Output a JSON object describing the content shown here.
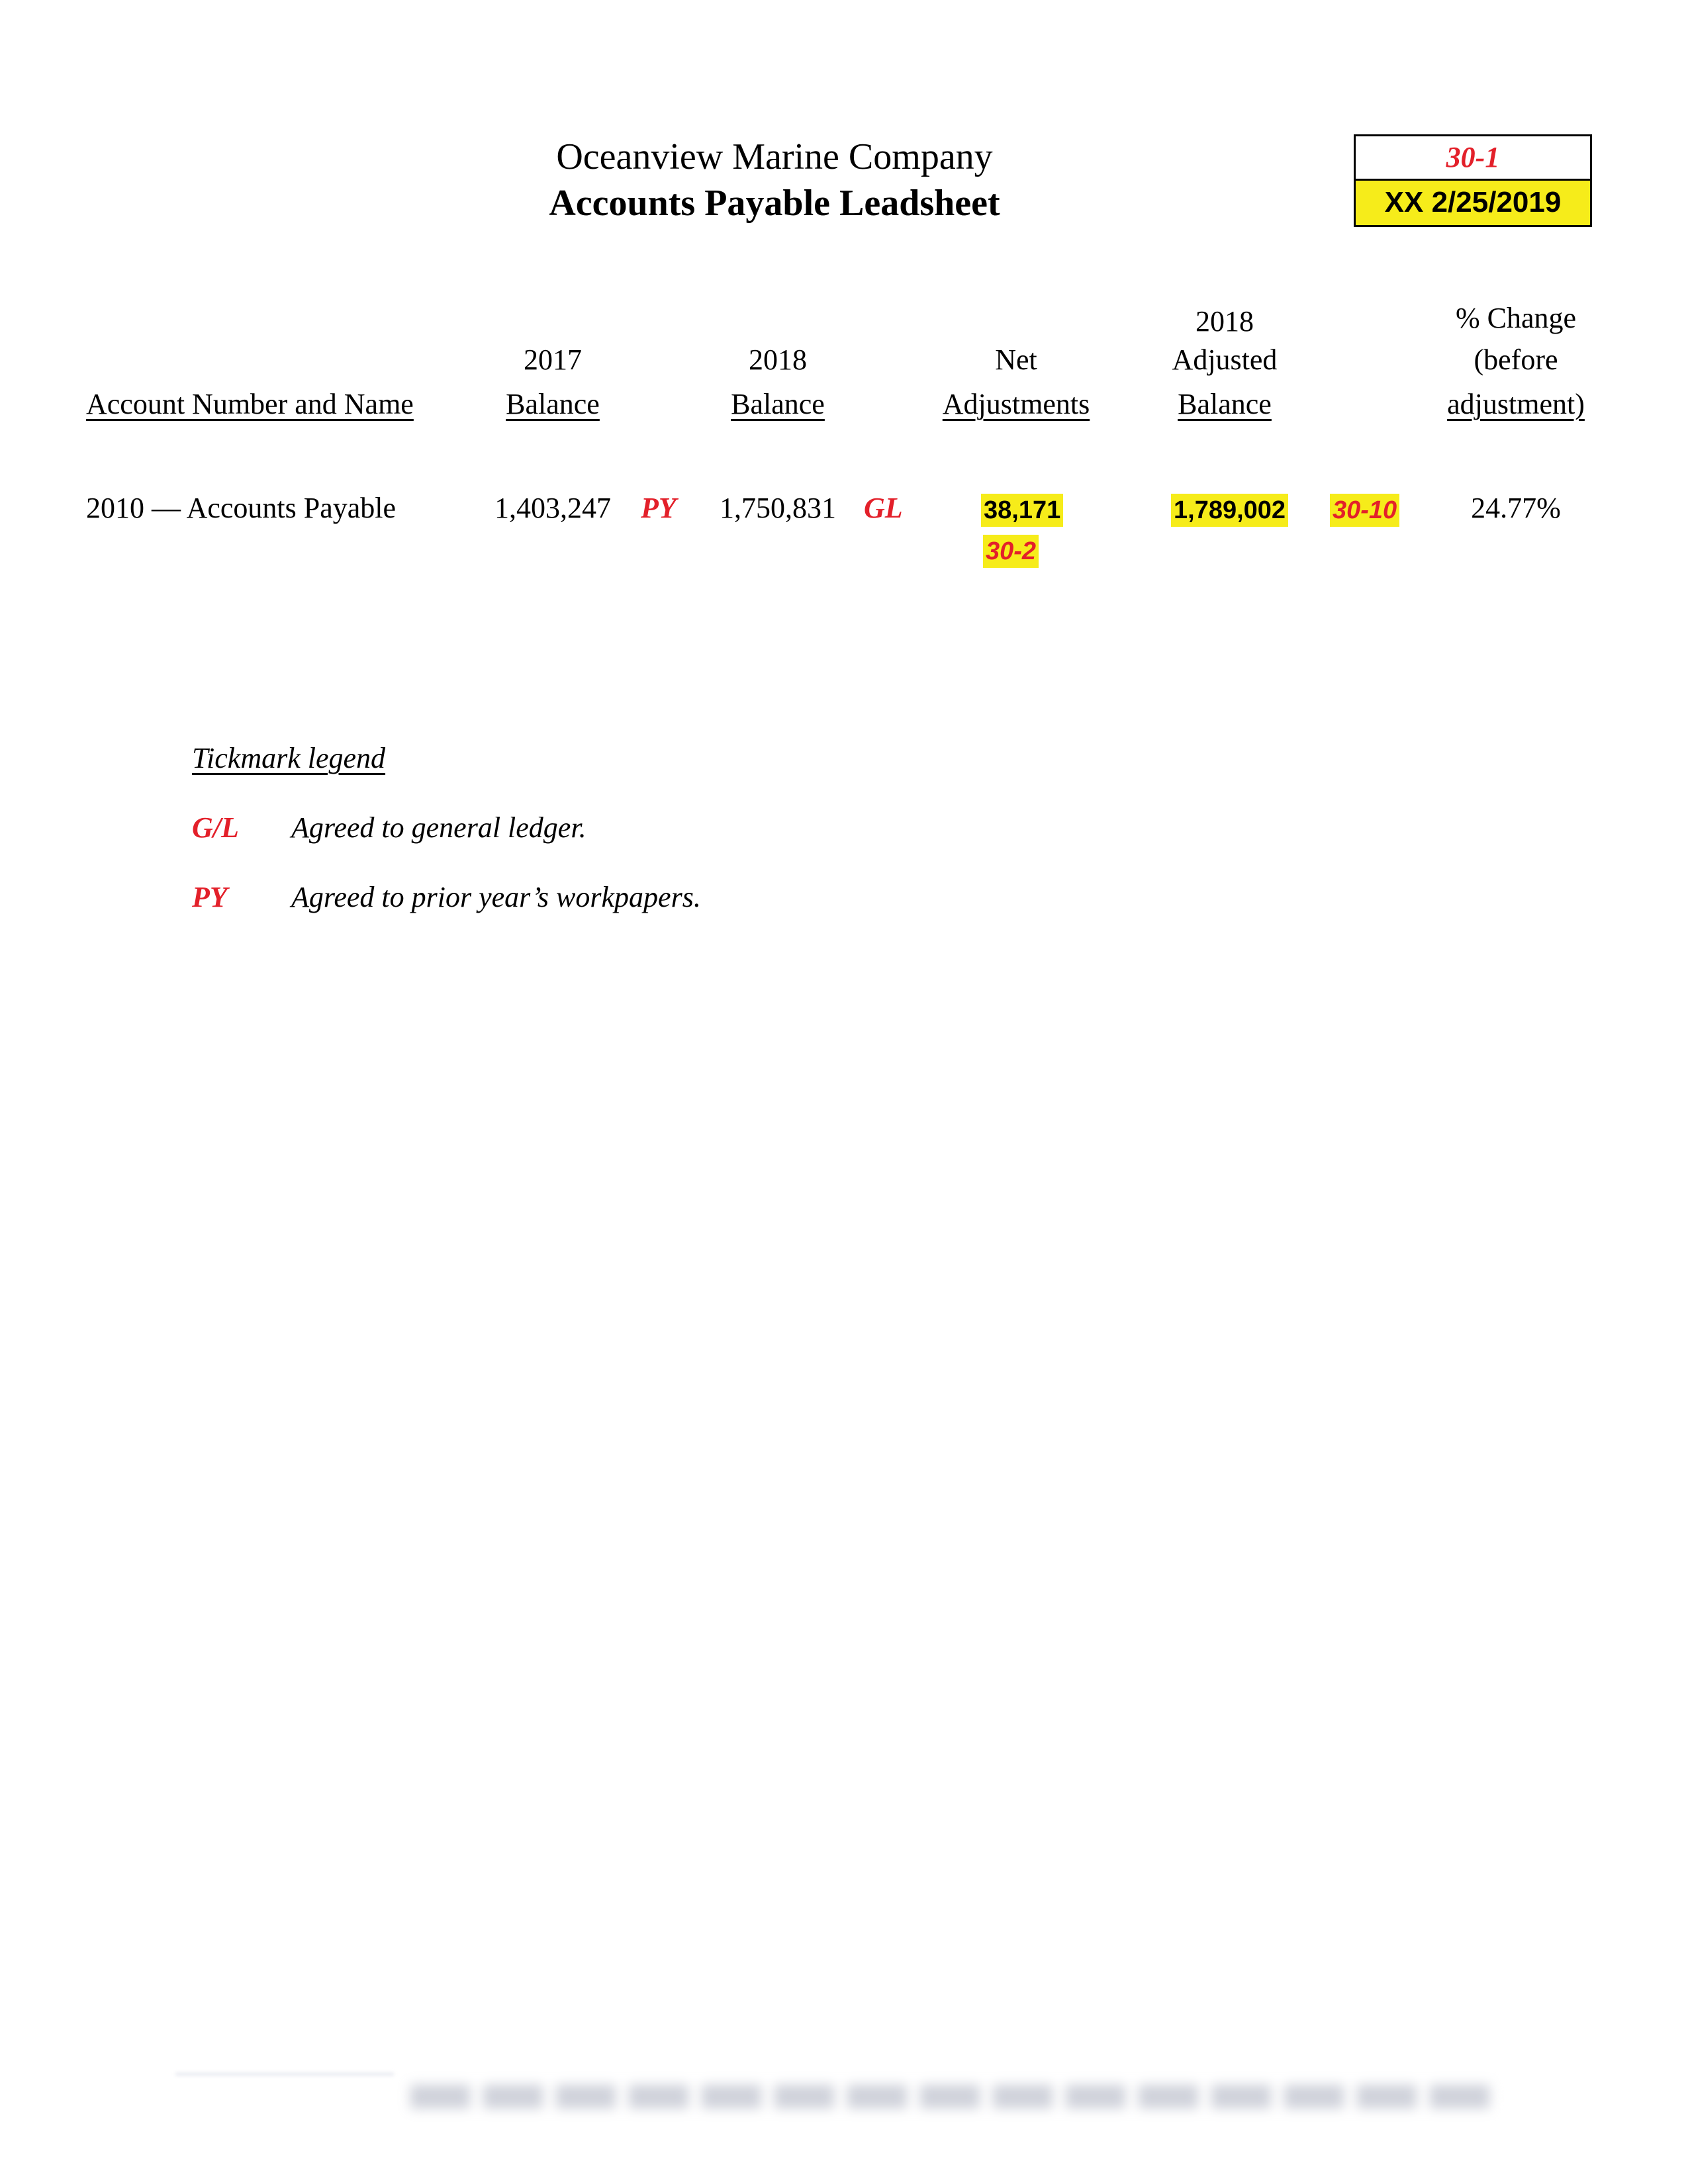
{
  "header": {
    "company": "Oceanview Marine Company",
    "title": "Accounts Payable Leadsheet",
    "ref_box": {
      "workpaper_ref": "30-1",
      "preparer_date": "XX  2/25/2019",
      "highlight_color": "#f6ec1a"
    }
  },
  "table": {
    "columns": [
      {
        "id": "account",
        "lines": [
          "Account Number and Name"
        ]
      },
      {
        "id": "bal_2017",
        "lines": [
          "2017",
          "Balance"
        ]
      },
      {
        "id": "bal_2018",
        "lines": [
          "2018",
          "Balance"
        ]
      },
      {
        "id": "net_adj",
        "lines": [
          "Net",
          "Adjustments"
        ]
      },
      {
        "id": "adj_bal_2018",
        "lines": [
          "2018",
          "Adjusted",
          "Balance"
        ]
      },
      {
        "id": "pct_change",
        "lines": [
          "% Change",
          "(before",
          "adjustment)"
        ]
      }
    ],
    "rows": [
      {
        "account": "2010 — Accounts Payable",
        "bal_2017": "1,403,247",
        "bal_2017_tick": "PY",
        "bal_2018": "1,750,831",
        "bal_2018_tick": "GL",
        "net_adj": "38,171",
        "net_adj_ref": "30-2",
        "adj_bal_2018": "1,789,002",
        "adj_bal_2018_ref": "30-10",
        "pct_change": "24.77%"
      }
    ]
  },
  "legend": {
    "title": "Tickmark legend",
    "items": [
      {
        "mark": "G/L",
        "description": "Agreed to general ledger."
      },
      {
        "mark": "PY",
        "description": "Agreed to prior year’s workpapers."
      }
    ]
  },
  "colors": {
    "tickmark_red": "#e3202a",
    "highlight_yellow": "#f6ec1a",
    "text": "#000000"
  }
}
